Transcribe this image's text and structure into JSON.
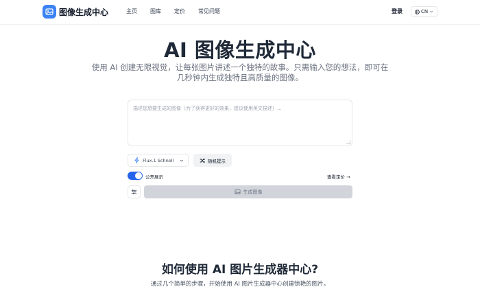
{
  "header": {
    "brand": "图像生成中心",
    "nav": [
      "主页",
      "图库",
      "定价",
      "常见问题"
    ],
    "login": "登录",
    "lang": "CN"
  },
  "hero": {
    "title": "AI 图像生成中心",
    "subtitle": "使用 AI 创建无限视觉，让每张图片讲述一个独特的故事。只需输入您的想法，即可在几秒钟内生成独特且高质量的图像。"
  },
  "generator": {
    "prompt_placeholder": "描述您想要生成的图像（为了获得更好的效果，建议使用英文描述）...",
    "model": "Flux.1 Schnell",
    "random_label": "随机提示",
    "public_label": "公开展示",
    "public_enabled": true,
    "pricing_link": "查看定价 →",
    "generate_label": "生成图像"
  },
  "how_to": {
    "title": "如何使用 AI 图片生成器中心?",
    "subtitle": "通过几个简单的步骤，开始使用 AI 图片生成器中心创建惊艳的图片。"
  },
  "colors": {
    "accent": "#3b82f6",
    "toggle_on": "#2563eb",
    "generate_disabled": "#d1d5db"
  }
}
